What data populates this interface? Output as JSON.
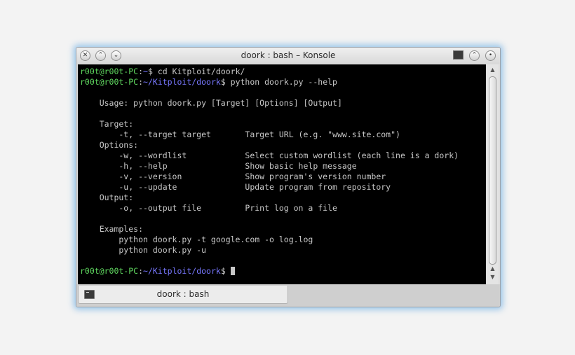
{
  "window": {
    "title": "doork : bash – Konsole"
  },
  "titlebar": {
    "close_icon": "✕",
    "minimize_icon": "⌃",
    "maximize_icon": "⌄",
    "keep_above_icon": "⌃",
    "menu_icon": "•"
  },
  "terminal": {
    "prompt_user_host": "r00t@r00t-PC",
    "prompt_sep": ":",
    "line1": {
      "path": "~",
      "cmd": "$ cd Kitploit/doork/"
    },
    "line2": {
      "path": "~/Kitploit/doork",
      "cmd": "$ python doork.py --help"
    },
    "output": "\n    Usage: python doork.py [Target] [Options] [Output]\n\n    Target:\n        -t, --target target       Target URL (e.g. \"www.site.com\")\n    Options:\n        -w, --wordlist            Select custom wordlist (each line is a dork)\n        -h, --help                Show basic help message\n        -v, --version             Show program's version number\n        -u, --update              Update program from repository\n    Output:\n        -o, --output file         Print log on a file\n\n    Examples:\n        python doork.py -t google.com -o log.log\n        python doork.py -u\n",
    "line_last": {
      "path": "~/Kitploit/doork",
      "cmd": "$ "
    }
  },
  "scrollbar": {
    "up_icon": "▲",
    "down_icon": "▼"
  },
  "tabs": [
    {
      "label": "doork : bash"
    }
  ]
}
